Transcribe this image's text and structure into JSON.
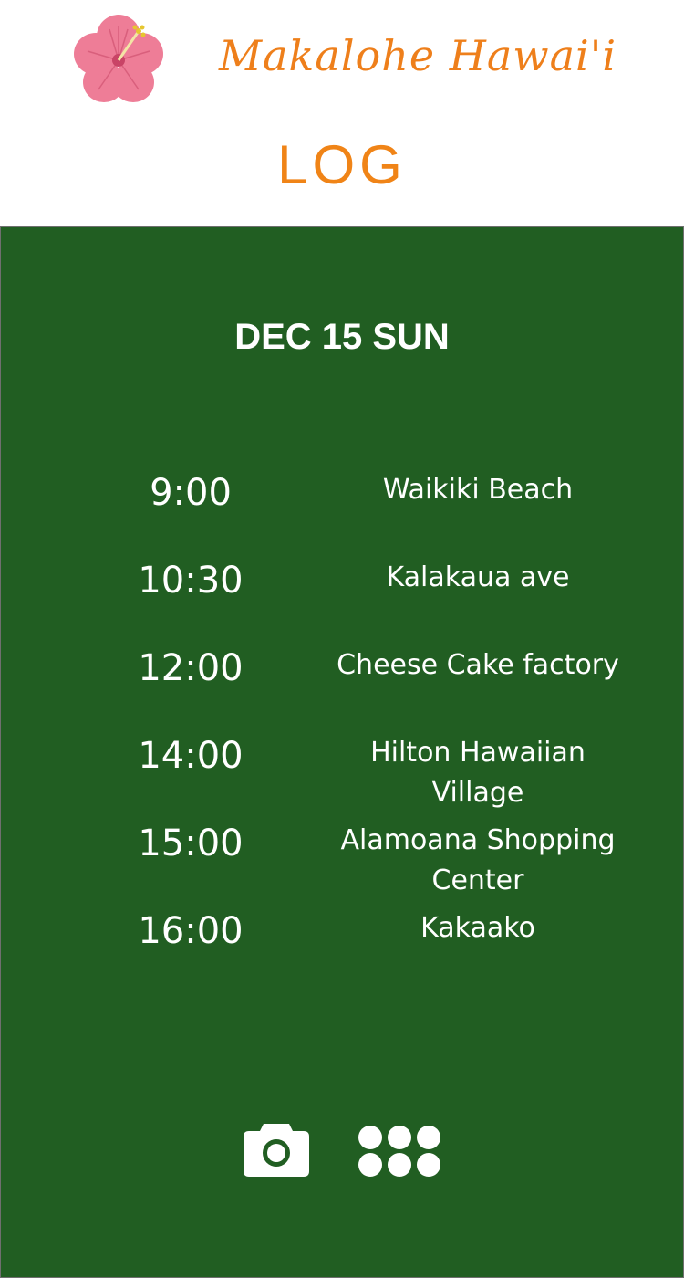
{
  "header": {
    "app_title": "Makalohe Hawai'i",
    "page_title": "LOG",
    "logo_icon": "hibiscus-flower-icon"
  },
  "log": {
    "date": "DEC 15 SUN",
    "entries": [
      {
        "time": "9:00",
        "place": "Waikiki Beach"
      },
      {
        "time": "10:30",
        "place": "Kalakaua ave"
      },
      {
        "time": "12:00",
        "place": "Cheese Cake factory"
      },
      {
        "time": "14:00",
        "place": "Hilton Hawaiian Village"
      },
      {
        "time": "15:00",
        "place": "Alamoana Shopping Center"
      },
      {
        "time": "16:00",
        "place": "Kakaako"
      }
    ]
  },
  "toolbar": {
    "camera_icon": "camera-icon",
    "grid_icon": "grid-dots-icon"
  },
  "colors": {
    "accent_orange": "#ee7f1b",
    "panel_green": "#215e22",
    "hibiscus_pink": "#ee7d97",
    "text_white": "#ffffff"
  }
}
